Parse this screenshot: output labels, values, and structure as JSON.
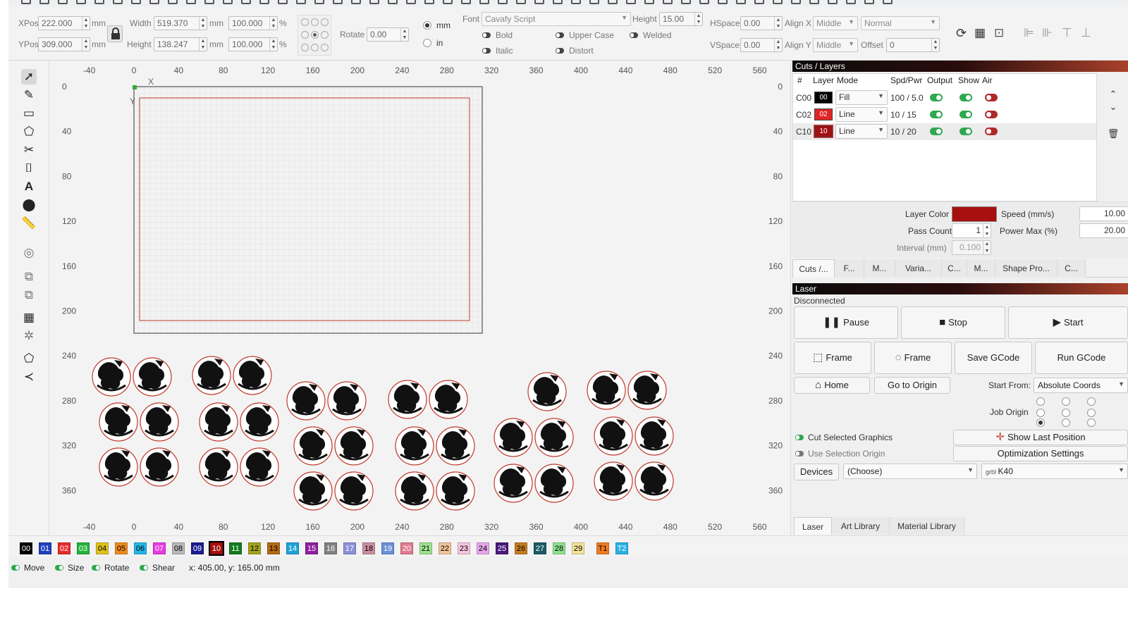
{
  "props": {
    "xpos_label": "XPos",
    "xpos": "222.000",
    "ypos_label": "YPos",
    "ypos": "309.000",
    "unit_mm": "mm",
    "width_label": "Width",
    "width": "519.370",
    "height_label": "Height",
    "height": "138.247",
    "width_pct": "100.000",
    "height_pct": "100.000",
    "pct": "%",
    "rotate_label": "Rotate",
    "rotate": "0.00",
    "unit_opt_mm": "mm",
    "unit_opt_in": "in",
    "font_label": "Font",
    "font_value": "Cavafy Script",
    "font_height_label": "Height",
    "font_height": "15.00",
    "bold": "Bold",
    "italic": "Italic",
    "upper_case": "Upper Case",
    "distort": "Distort",
    "welded": "Welded",
    "hspace_label": "HSpace",
    "hspace": "0.00",
    "vspace_label": "VSpace",
    "vspace": "0.00",
    "alignx_label": "Align X",
    "alignx": "Middle",
    "aligny_label": "Align Y",
    "aligny": "Middle",
    "normal": "Normal",
    "offset_label": "Offset",
    "offset": "0"
  },
  "rulers": {
    "x_labels": [
      "-40",
      "0",
      "40",
      "80",
      "120",
      "160",
      "200",
      "240",
      "280",
      "320",
      "360",
      "400",
      "440",
      "480",
      "520",
      "560"
    ],
    "y_labels": [
      "0",
      "40",
      "80",
      "120",
      "160",
      "200",
      "240",
      "280",
      "320",
      "360"
    ]
  },
  "canvas": {
    "origin_x": "X",
    "origin_y": "Y"
  },
  "cuts_panel": {
    "title": "Cuts / Layers",
    "headers": [
      "#",
      "Layer",
      "Mode",
      "Spd/Pwr",
      "Output",
      "Show",
      "Air"
    ],
    "rows": [
      {
        "id": "C00",
        "layer": "00",
        "color": "#000000",
        "mode": "Fill",
        "spd_pwr": "100 / 5.0"
      },
      {
        "id": "C02",
        "layer": "02",
        "color": "#e02424",
        "mode": "Line",
        "spd_pwr": "10 / 15"
      },
      {
        "id": "C10",
        "layer": "10",
        "color": "#a11010",
        "mode": "Line",
        "spd_pwr": "10 / 20"
      }
    ],
    "layer_color_label": "Layer Color",
    "layer_color": "#a80f0f",
    "speed_label": "Speed (mm/s)",
    "speed": "10.00",
    "pass_count_label": "Pass Count",
    "pass_count": "1",
    "power_max_label": "Power Max (%)",
    "power_max": "20.00",
    "interval_label": "Interval (mm)",
    "interval": "0.100",
    "tabs": [
      "Cuts /...",
      "F...",
      "M...",
      "Varia...",
      "C...",
      "M...",
      "Shape Pro...",
      "C..."
    ]
  },
  "laser_panel": {
    "title": "Laser",
    "status": "Disconnected",
    "pause": "Pause",
    "stop": "Stop",
    "start": "Start",
    "frame1": "Frame",
    "frame2": "Frame",
    "save_gcode": "Save GCode",
    "run_gcode": "Run GCode",
    "home": "Home",
    "go_to_origin": "Go to Origin",
    "start_from_label": "Start From:",
    "start_from": "Absolute Coords",
    "job_origin_label": "Job Origin",
    "cut_selected": "Cut Selected Graphics",
    "use_selection_origin": "Use Selection Origin",
    "show_last_position": "Show Last Position",
    "optimization_settings": "Optimization Settings",
    "devices": "Devices",
    "devices_choice": "(Choose)",
    "device_name": "K40",
    "bottom_tabs": [
      "Laser",
      "Art Library",
      "Material Library"
    ]
  },
  "palette": [
    {
      "label": "00",
      "color": "#000000",
      "fg": "#ffffff"
    },
    {
      "label": "01",
      "color": "#1f3fbf",
      "fg": "#ffffff"
    },
    {
      "label": "02",
      "color": "#e52b2b",
      "fg": "#ffffff"
    },
    {
      "label": "03",
      "color": "#22b33a",
      "fg": "#ffffff"
    },
    {
      "label": "04",
      "color": "#e0c21e",
      "fg": "#000000"
    },
    {
      "label": "05",
      "color": "#ef8b1e",
      "fg": "#000000"
    },
    {
      "label": "06",
      "color": "#24b7e8",
      "fg": "#000000"
    },
    {
      "label": "07",
      "color": "#e63be0",
      "fg": "#ffffff"
    },
    {
      "label": "08",
      "color": "#b9b9b9",
      "fg": "#000000"
    },
    {
      "label": "09",
      "color": "#1c1c8f",
      "fg": "#ffffff"
    },
    {
      "label": "10",
      "color": "#a80f0f",
      "fg": "#ffffff"
    },
    {
      "label": "11",
      "color": "#137a1f",
      "fg": "#ffffff"
    },
    {
      "label": "12",
      "color": "#a3a31d",
      "fg": "#000000"
    },
    {
      "label": "13",
      "color": "#b36a14",
      "fg": "#000000"
    },
    {
      "label": "14",
      "color": "#1ea2d6",
      "fg": "#ffffff"
    },
    {
      "label": "15",
      "color": "#8e1f9e",
      "fg": "#ffffff"
    },
    {
      "label": "16",
      "color": "#808080",
      "fg": "#ffffff"
    },
    {
      "label": "17",
      "color": "#8c90d6",
      "fg": "#ffffff"
    },
    {
      "label": "18",
      "color": "#c98ea0",
      "fg": "#000000"
    },
    {
      "label": "19",
      "color": "#6a8fd8",
      "fg": "#ffffff"
    },
    {
      "label": "20",
      "color": "#e0798f",
      "fg": "#ffffff"
    },
    {
      "label": "21",
      "color": "#9ee08e",
      "fg": "#000000"
    },
    {
      "label": "22",
      "color": "#f1c49a",
      "fg": "#000000"
    },
    {
      "label": "23",
      "color": "#f6c4dd",
      "fg": "#000000"
    },
    {
      "label": "24",
      "color": "#e7a7ec",
      "fg": "#000000"
    },
    {
      "label": "25",
      "color": "#4a1a7a",
      "fg": "#ffffff"
    },
    {
      "label": "26",
      "color": "#c77b1e",
      "fg": "#000000"
    },
    {
      "label": "27",
      "color": "#1b5a64",
      "fg": "#ffffff"
    },
    {
      "label": "28",
      "color": "#8ee08e",
      "fg": "#000000"
    },
    {
      "label": "29",
      "color": "#f2e29a",
      "fg": "#000000"
    },
    {
      "label": "T1",
      "color": "#ef7b22",
      "fg": "#000000"
    },
    {
      "label": "T2",
      "color": "#2ab1e6",
      "fg": "#ffffff"
    }
  ],
  "status": {
    "move": "Move",
    "size": "Size",
    "rotate": "Rotate",
    "shear": "Shear",
    "coords": "x: 405.00, y: 165.00 mm"
  }
}
